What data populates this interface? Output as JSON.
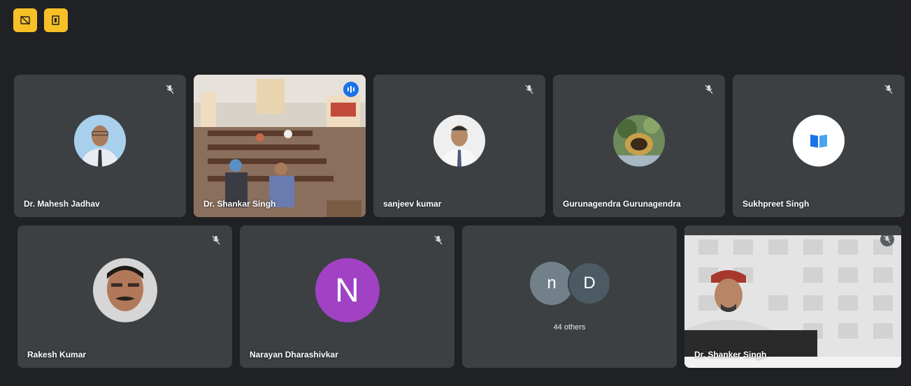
{
  "toolbar": {
    "buttons": [
      {
        "icon": "captions-off-icon"
      },
      {
        "icon": "door-exit-icon"
      }
    ],
    "accent": "#f6c026"
  },
  "participants_row1": [
    {
      "name": "Dr. Mahesh Jadhav",
      "muted": true,
      "avatar": "photo"
    },
    {
      "name": "Dr. Shankar Singh",
      "muted": false,
      "speaking": true,
      "avatar": "video"
    },
    {
      "name": "sanjeev kumar",
      "muted": true,
      "avatar": "photo"
    },
    {
      "name": "Gurunagendra Gurunagendra",
      "muted": true,
      "avatar": "photo"
    },
    {
      "name": "Sukhpreet Singh",
      "muted": true,
      "avatar": "book-icon"
    }
  ],
  "participants_row2": [
    {
      "name": "Rakesh Kumar",
      "muted": true,
      "avatar": "photo"
    },
    {
      "name": "Narayan Dharashivkar",
      "muted": true,
      "avatar": "letter",
      "letter": "N",
      "color": "#a142c4"
    },
    {
      "name": "",
      "others": {
        "letters": [
          "n",
          "D"
        ],
        "label": "44 others"
      }
    },
    {
      "name": "Dr. Shanker Singh",
      "muted": true,
      "avatar": "video"
    }
  ],
  "colors": {
    "background": "#202124",
    "tile": "#3c4043",
    "active_outline": "#8ab4f8",
    "speaking_badge": "#1a73e8"
  }
}
